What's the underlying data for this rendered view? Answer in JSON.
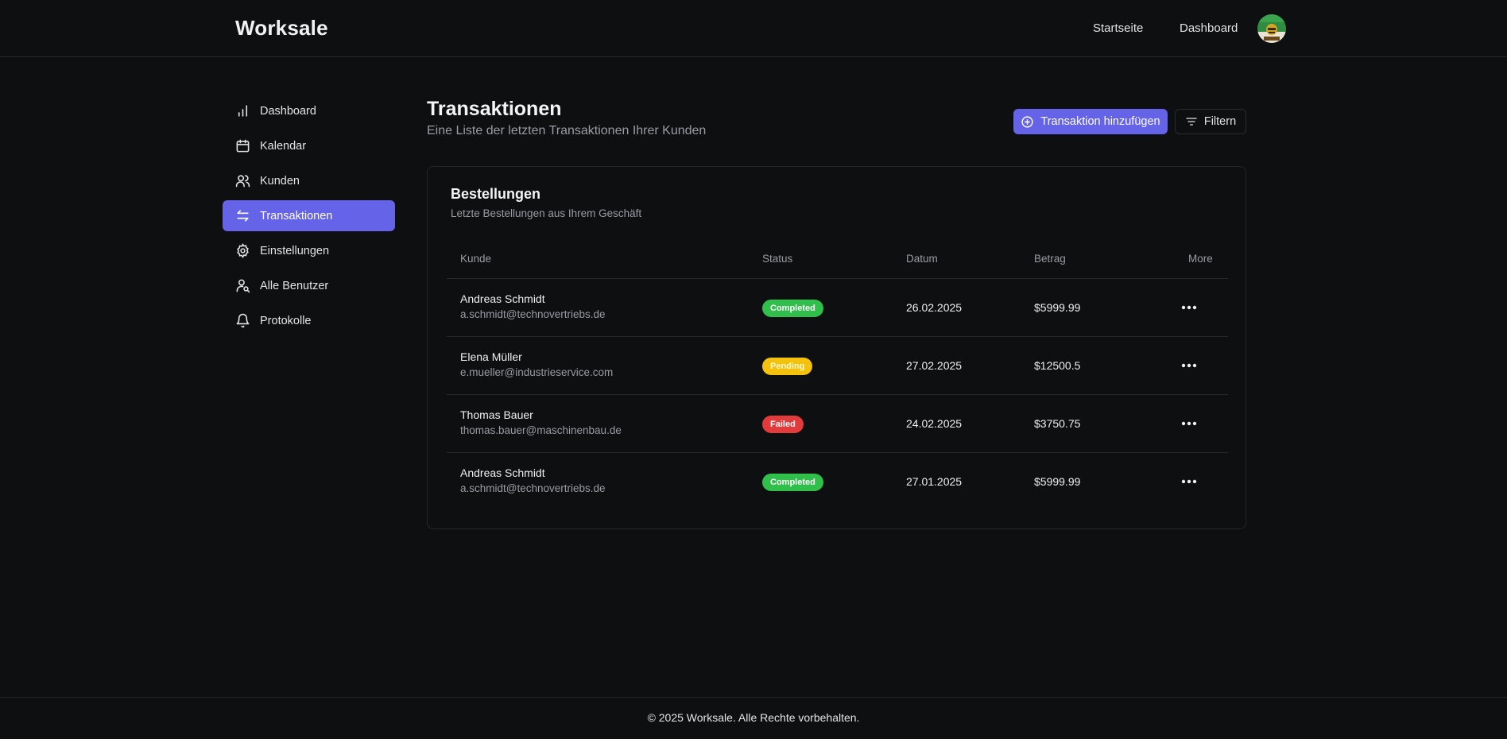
{
  "app": {
    "brand": "Worksale"
  },
  "topnav": {
    "home": "Startseite",
    "dashboard": "Dashboard"
  },
  "sidebar": {
    "items": [
      {
        "label": "Dashboard",
        "icon": "bar-chart-icon"
      },
      {
        "label": "Kalendar",
        "icon": "calendar-icon"
      },
      {
        "label": "Kunden",
        "icon": "users-icon"
      },
      {
        "label": "Transaktionen",
        "icon": "arrows-left-right-icon",
        "active": true
      },
      {
        "label": "Einstellungen",
        "icon": "gear-icon"
      },
      {
        "label": "Alle Benutzer",
        "icon": "user-search-icon"
      },
      {
        "label": "Protokolle",
        "icon": "bell-icon"
      }
    ]
  },
  "page": {
    "title": "Transaktionen",
    "subtitle": "Eine Liste der letzten Transaktionen Ihrer Kunden",
    "add_button": "Transaktion hinzufügen",
    "filter_button": "Filtern"
  },
  "card": {
    "title": "Bestellungen",
    "subtitle": "Letzte Bestellungen aus Ihrem Geschäft",
    "columns": [
      "Kunde",
      "Status",
      "Datum",
      "Betrag",
      "More"
    ],
    "rows": [
      {
        "name": "Andreas Schmidt",
        "email": "a.schmidt@technovertriebs.de",
        "status": "Completed",
        "date": "26.02.2025",
        "amount": "$5999.99"
      },
      {
        "name": "Elena Müller",
        "email": "e.mueller@industrieservice.com",
        "status": "Pending",
        "date": "27.02.2025",
        "amount": "$12500.5"
      },
      {
        "name": "Thomas Bauer",
        "email": "thomas.bauer@maschinenbau.de",
        "status": "Failed",
        "date": "24.02.2025",
        "amount": "$3750.75"
      },
      {
        "name": "Andreas Schmidt",
        "email": "a.schmidt@technovertriebs.de",
        "status": "Completed",
        "date": "27.01.2025",
        "amount": "$5999.99"
      }
    ]
  },
  "footer": {
    "text": "© 2025 Worksale. Alle Rechte vorbehalten."
  },
  "colors": {
    "accent": "#6563e8",
    "completed": "#2fbf4a",
    "pending": "#f4c20d",
    "failed": "#e33b3b",
    "background": "#0e0f11"
  }
}
